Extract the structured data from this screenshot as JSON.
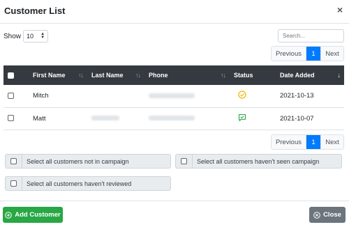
{
  "modal": {
    "title": "Customer List",
    "close_glyph": "×"
  },
  "controls": {
    "show_label": "Show",
    "page_size": "10",
    "search_placeholder": "Search..."
  },
  "pagination": {
    "previous": "Previous",
    "current": "1",
    "next": "Next"
  },
  "table": {
    "columns": [
      "First Name",
      "Last Name",
      "Phone",
      "Status",
      "Date Added"
    ],
    "rows": [
      {
        "first_name": "Mitch",
        "last_name": "",
        "phone": "",
        "status": "check-circle-icon",
        "date_added": "2021-10-13"
      },
      {
        "first_name": "Matt",
        "last_name": "",
        "phone": "",
        "status": "check-message-icon",
        "date_added": "2021-10-07"
      }
    ]
  },
  "filters": {
    "not_in_campaign": "Select all customers not in campaign",
    "havent_seen": "Select all customers haven't seen campaign",
    "havent_reviewed": "Select all customers haven't reviewed"
  },
  "footer": {
    "add_customer": "Add Customer",
    "close": "Close"
  },
  "colors": {
    "header_dark": "#343a40",
    "primary": "#007bff",
    "success": "#28a745",
    "secondary": "#6c757d",
    "status_yellow": "#f0b400",
    "status_green": "#28a745"
  }
}
